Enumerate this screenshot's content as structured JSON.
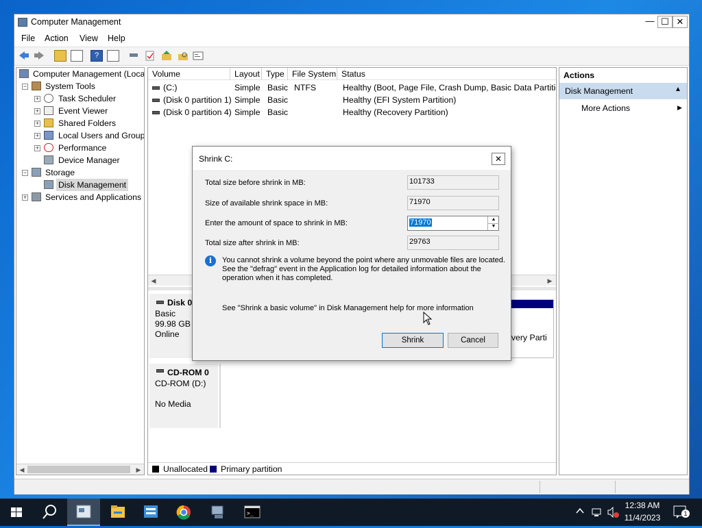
{
  "window": {
    "title": "Computer Management",
    "minimize": "—",
    "maximize": "☐",
    "close": "✕"
  },
  "menu": [
    "File",
    "Action",
    "View",
    "Help"
  ],
  "tree": {
    "root": "Computer Management (Local",
    "system_tools": "System Tools",
    "task_scheduler": "Task Scheduler",
    "event_viewer": "Event Viewer",
    "shared_folders": "Shared Folders",
    "local_users": "Local Users and Groups",
    "performance": "Performance",
    "device_manager": "Device Manager",
    "storage": "Storage",
    "disk_management": "Disk Management",
    "services": "Services and Applications"
  },
  "volumes": {
    "headers": [
      "Volume",
      "Layout",
      "Type",
      "File System",
      "Status"
    ],
    "rows": [
      {
        "volume": "(C:)",
        "layout": "Simple",
        "type": "Basic",
        "fs": "NTFS",
        "status": "Healthy (Boot, Page File, Crash Dump, Basic Data Partition)"
      },
      {
        "volume": "(Disk 0 partition 1)",
        "layout": "Simple",
        "type": "Basic",
        "fs": "",
        "status": "Healthy (EFI System Partition)"
      },
      {
        "volume": "(Disk 0 partition 4)",
        "layout": "Simple",
        "type": "Basic",
        "fs": "",
        "status": "Healthy (Recovery Partition)"
      }
    ]
  },
  "disk0": {
    "name": "Disk 0",
    "type": "Basic",
    "size": "99.98 GB",
    "state": "Online",
    "partition_fragment": "overy Parti"
  },
  "cdrom": {
    "name": "CD-ROM 0",
    "label": "CD-ROM (D:)",
    "media": "No Media"
  },
  "legend": {
    "unallocated": "Unallocated",
    "primary": "Primary partition"
  },
  "actions": {
    "header": "Actions",
    "section": "Disk Management",
    "more": "More Actions"
  },
  "dialog": {
    "title": "Shrink C:",
    "close": "✕",
    "total_before_label": "Total size before shrink in MB:",
    "total_before": "101733",
    "available_label": "Size of available shrink space in MB:",
    "available": "71970",
    "enter_label": "Enter the amount of space to shrink in MB:",
    "enter_value": "71970",
    "after_label": "Total size after shrink in MB:",
    "after": "29763",
    "info_line1": "You cannot shrink a volume beyond the point where any unmovable files are located.",
    "info_line2": "See the \"defrag\" event in the Application log for detailed information about the",
    "info_line3": "operation when it has completed.",
    "help": "See \"Shrink a basic volume\" in Disk Management help for more information",
    "shrink": "Shrink",
    "cancel": "Cancel"
  },
  "clock": {
    "time": "12:38 AM",
    "date": "11/4/2023"
  },
  "notification_count": "1",
  "colors": {
    "primary_partition": "#00007f",
    "unallocated": "#000000",
    "selection": "#cce8ff",
    "taskbar": "#101a26"
  }
}
